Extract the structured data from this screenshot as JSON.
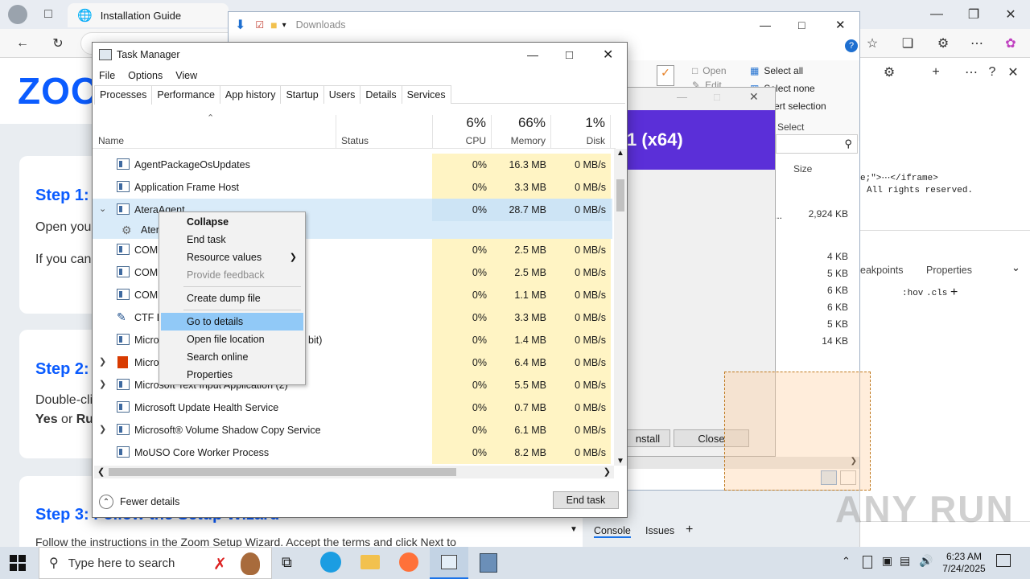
{
  "browser": {
    "tab_title": "Installation Guide",
    "page": {
      "logo": "ZOO",
      "step1": {
        "title": "Step 1: I",
        "line1": "Open your",
        "line2": "If you can't"
      },
      "step2": {
        "title": "Step 2: I",
        "line1": "Double-cli",
        "line2a": "Yes",
        "line2b": " or ",
        "line2c": "Ru"
      },
      "step3": {
        "title": "Step 3: Follow the Setup Wizard",
        "line1": "Follow the instructions in the Zoom Setup Wizard. Accept the terms and click Next to"
      }
    }
  },
  "devtools": {
    "code1": "e;\">⋯</iframe>",
    "code2": "All rights reserved.",
    "tab_breakpoints": "eakpoints",
    "tab_properties": "Properties",
    "filter_hov": ":hov",
    "filter_cls": ".cls",
    "console_tab": "Console",
    "issues_tab": "Issues"
  },
  "explorer": {
    "title": "Downloads",
    "open_label": "Open",
    "edit_label": "Edit",
    "select_all": "Select all",
    "select_none": "Select none",
    "invert_selection": "vert selection",
    "select_group": "Select",
    "size_header": "Size",
    "sizes": [
      "2,924 KB",
      "4 KB",
      "5 KB",
      "6 KB",
      "6 KB",
      "5 KB",
      "14 KB"
    ]
  },
  "installer": {
    "banner": "1 (x64)",
    "install_label": "nstall",
    "close_label": "Close"
  },
  "taskmgr": {
    "title": "Task Manager",
    "menu": [
      "File",
      "Options",
      "View"
    ],
    "tabs": [
      "Processes",
      "Performance",
      "App history",
      "Startup",
      "Users",
      "Details",
      "Services"
    ],
    "columns": {
      "name": "Name",
      "status": "Status",
      "cpu_pct": "6%",
      "cpu": "CPU",
      "mem_pct": "66%",
      "mem": "Memory",
      "disk_pct": "1%",
      "disk": "Disk"
    },
    "rows": [
      {
        "name": "AgentPackageOsUpdates",
        "cpu": "0%",
        "mem": "16.3 MB",
        "disk": "0 MB/s"
      },
      {
        "name": "Application Frame Host",
        "cpu": "0%",
        "mem": "3.3 MB",
        "disk": "0 MB/s"
      },
      {
        "name": "AteraAgent",
        "cpu": "0%",
        "mem": "28.7 MB",
        "disk": "0 MB/s"
      },
      {
        "name": "Atera",
        "cpu": "",
        "mem": "",
        "disk": ""
      },
      {
        "name": "COM",
        "cpu": "0%",
        "mem": "2.5 MB",
        "disk": "0 MB/s"
      },
      {
        "name": "COM",
        "cpu": "0%",
        "mem": "2.5 MB",
        "disk": "0 MB/s"
      },
      {
        "name": "COM",
        "cpu": "0%",
        "mem": "1.1 MB",
        "disk": "0 MB/s"
      },
      {
        "name": "CTF L",
        "cpu": "0%",
        "mem": "3.3 MB",
        "disk": "0 MB/s"
      },
      {
        "name": "Micro",
        "suffix": "bit)",
        "cpu": "0%",
        "mem": "1.4 MB",
        "disk": "0 MB/s"
      },
      {
        "name": "Micro",
        "cpu": "0%",
        "mem": "6.4 MB",
        "disk": "0 MB/s"
      },
      {
        "name": "Microsoft Text Input Application (2)",
        "cpu": "0%",
        "mem": "5.5 MB",
        "disk": "0 MB/s"
      },
      {
        "name": "Microsoft Update Health Service",
        "cpu": "0%",
        "mem": "0.7 MB",
        "disk": "0 MB/s"
      },
      {
        "name": "Microsoft® Volume Shadow Copy Service",
        "cpu": "0%",
        "mem": "6.1 MB",
        "disk": "0 MB/s"
      },
      {
        "name": "MoUSO Core Worker Process",
        "cpu": "0%",
        "mem": "8.2 MB",
        "disk": "0 MB/s"
      }
    ],
    "fewer_details": "Fewer details",
    "end_task": "End task"
  },
  "context_menu": {
    "collapse": "Collapse",
    "end_task": "End task",
    "resource_values": "Resource values",
    "provide_feedback": "Provide feedback",
    "create_dump": "Create dump file",
    "go_to_details": "Go to details",
    "open_file_location": "Open file location",
    "search_online": "Search online",
    "properties": "Properties"
  },
  "taskbar": {
    "search_placeholder": "Type here to search",
    "time": "6:23 AM",
    "date": "7/24/2025"
  },
  "watermark": "ANY RUN",
  "colors": {
    "accent": "#0b5cff",
    "highlight": "#91c9f7",
    "cpu_heat": "#fff4c4",
    "installer_banner": "#5b2fd8"
  }
}
